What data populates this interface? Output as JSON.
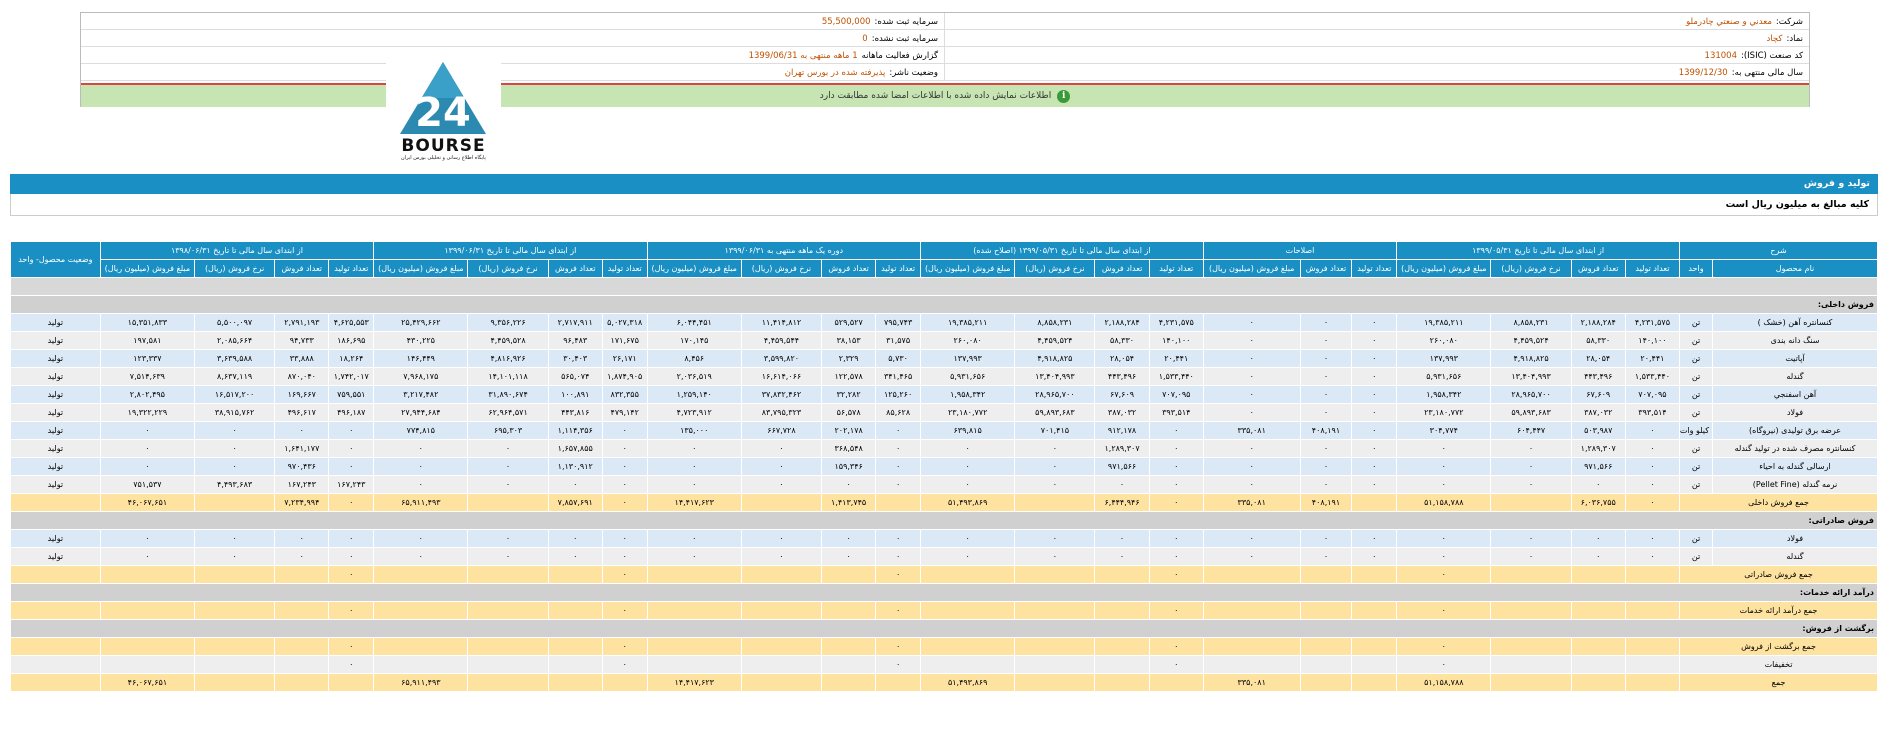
{
  "company": {
    "company_label": "شرکت:",
    "company_value": "معدني و صنعتي چادرملو",
    "symbol_label": "نماد:",
    "symbol_value": "کچاد",
    "isic_label": "کد صنعت (ISIC):",
    "isic_value": "131004",
    "fiscal_label": "سال مالی منتهی به:",
    "fiscal_value": "1399/12/30",
    "capital_label": "سرمایه ثبت شده:",
    "capital_value": "55,500,000",
    "unreg_label": "سرمایه ثبت نشده:",
    "unreg_value": "0",
    "report_label": "گزارش فعالیت ماهانه",
    "report_value": "1 ماهه منتهی به 1399/06/31",
    "status_label": "وضعیت ناشر:",
    "status_value": "پذیرفته شده در بورس تهران"
  },
  "notice": "اطلاعات نمایش داده شده با اطلاعات امضا شده مطابقت دارد",
  "logo": {
    "text": "BOURSE",
    "sub": "پایگاه اطلاع رسانی و تحلیلی بورس ایران",
    "mark": "24"
  },
  "section_title": "تولید و فروش",
  "section_note": "کلیه مبالغ به میلیون ریال است",
  "head": {
    "g0": "شرح",
    "g1": "از ابتدای سال مالی تا تاریخ ۱۳۹۹/۰۵/۳۱",
    "g2": "اصلاحات",
    "g3": "از ابتدای سال مالی تا تاریخ ۱۳۹۹/۰۵/۳۱ (اصلاح شده)",
    "g4": "دوره یک ماهه منتهی به ۱۳۹۹/۰۶/۳۱",
    "g5": "از ابتدای سال مالی تا تاریخ ۱۳۹۹/۰۶/۳۱",
    "g6": "از ابتدای سال مالی تا تاریخ ۱۳۹۸/۰۶/۳۱",
    "g7": "وضعیت محصول- واحد",
    "name": "نام محصول",
    "unit": "واحد",
    "prod": "تعداد تولید",
    "salesq": "تعداد فروش",
    "rate": "نرخ فروش (ریال)",
    "amount": "مبلغ فروش (میلیون ریال)"
  },
  "sections": {
    "domestic": "فروش داخلی:",
    "export": "فروش صادراتی:",
    "services": "درآمد ارائه خدمات:",
    "returns": "برگشت از فروش:"
  },
  "rows": [
    {
      "n": "کنسانتره آهن (خشک )",
      "u": "تن",
      "c": [
        "۴,۲۳۱,۵۷۵",
        "۲,۱۸۸,۲۸۴",
        "۸,۸۵۸,۲۳۱",
        "۱۹,۳۸۵,۲۱۱",
        "۰",
        "۰",
        "۰",
        "۴,۲۳۱,۵۷۵",
        "۲,۱۸۸,۲۸۴",
        "۸,۸۵۸,۲۳۱",
        "۱۹,۳۸۵,۲۱۱",
        "۷۹۵,۷۴۳",
        "۵۲۹,۵۲۷",
        "۱۱,۴۱۴,۸۱۲",
        "۶,۰۴۴,۴۵۱",
        "۵,۰۲۷,۳۱۸",
        "۲,۷۱۷,۹۱۱",
        "۹,۳۵۶,۲۲۶",
        "۲۵,۴۲۹,۶۶۲",
        "۴,۶۲۵,۵۵۳",
        "۲,۷۹۱,۱۹۳",
        "۵,۵۰۰,۰۹۷",
        "۱۵,۳۵۱,۸۳۳"
      ],
      "s": "تولید",
      "k": "r1"
    },
    {
      "n": "سنگ دانه بندی",
      "u": "تن",
      "c": [
        "۱۴۰,۱۰۰",
        "۵۸,۳۳۰",
        "۴,۴۵۹,۵۲۴",
        "۲۶۰,۰۸۰",
        "۰",
        "۰",
        "۰",
        "۱۴۰,۱۰۰",
        "۵۸,۳۳۰",
        "۴,۴۵۹,۵۲۴",
        "۲۶۰,۰۸۰",
        "۳۱,۵۷۵",
        "۳۸,۱۵۳",
        "۴,۴۵۹,۵۴۴",
        "۱۷۰,۱۴۵",
        "۱۷۱,۶۷۵",
        "۹۶,۴۸۳",
        "۴,۴۵۹,۵۲۸",
        "۴۳۰,۲۲۵",
        "۱۸۶,۶۹۵",
        "۹۴,۷۳۳",
        "۲,۰۸۵,۶۶۴",
        "۱۹۷,۵۸۱"
      ],
      "s": "تولید",
      "k": "r2"
    },
    {
      "n": "آپاتیت",
      "u": "تن",
      "c": [
        "۲۰,۴۴۱",
        "۲۸,۰۵۴",
        "۴,۹۱۸,۸۲۵",
        "۱۳۷,۹۹۳",
        "۰",
        "۰",
        "۰",
        "۲۰,۴۴۱",
        "۲۸,۰۵۴",
        "۴,۹۱۸,۸۲۵",
        "۱۳۷,۹۹۳",
        "۵,۷۳۰",
        "۲,۳۲۹",
        "۳,۵۹۹,۸۲۰",
        "۸,۴۵۶",
        "۲۶,۱۷۱",
        "۳۰,۴۰۳",
        "۴,۸۱۶,۹۲۶",
        "۱۴۶,۴۴۹",
        "۱۸,۲۶۴",
        "۳۳,۸۸۸",
        "۳,۶۳۹,۵۸۸",
        "۱۲۳,۳۳۷"
      ],
      "s": "تولید",
      "k": "r1"
    },
    {
      "n": "گندله",
      "u": "تن",
      "c": [
        "۱,۵۳۳,۴۴۰",
        "۴۴۳,۴۹۶",
        "۱۳,۴۰۴,۹۹۳",
        "۵,۹۳۱,۶۵۶",
        "۰",
        "۰",
        "۰",
        "۱,۵۳۳,۴۴۰",
        "۴۴۳,۴۹۶",
        "۱۳,۴۰۴,۹۹۳",
        "۵,۹۳۱,۶۵۶",
        "۳۴۱,۴۶۵",
        "۱۲۲,۵۷۸",
        "۱۶,۶۱۴,۰۶۶",
        "۲,۰۳۶,۵۱۹",
        "۱,۸۷۴,۹۰۵",
        "۵۶۵,۰۷۴",
        "۱۴,۱۰۱,۱۱۸",
        "۷,۹۶۸,۱۷۵",
        "۱,۷۴۲,۰۱۷",
        "۸۷۰,۰۴۰",
        "۸,۶۳۷,۱۱۹",
        "۷,۵۱۴,۶۳۹"
      ],
      "s": "تولید",
      "k": "r2"
    },
    {
      "n": "آهن اسفنجي",
      "u": "تن",
      "c": [
        "۷۰۷,۰۹۵",
        "۶۷,۶۰۹",
        "۲۸,۹۶۵,۷۰۰",
        "۱,۹۵۸,۳۴۲",
        "۰",
        "۰",
        "۰",
        "۷۰۷,۰۹۵",
        "۶۷,۶۰۹",
        "۲۸,۹۶۵,۷۰۰",
        "۱,۹۵۸,۳۴۲",
        "۱۲۵,۲۶۰",
        "۳۲,۲۸۲",
        "۳۷,۸۳۲,۴۶۲",
        "۱,۲۵۹,۱۴۰",
        "۸۳۲,۳۵۵",
        "۱۰۰,۸۹۱",
        "۳۱,۸۹۰,۶۷۴",
        "۳,۲۱۷,۴۸۲",
        "۷۵۹,۵۵۱",
        "۱۶۹,۶۶۷",
        "۱۶,۵۱۷,۲۰۰",
        "۲,۸۰۲,۴۹۵"
      ],
      "s": "تولید",
      "k": "r1"
    },
    {
      "n": "فولاد",
      "u": "تن",
      "c": [
        "۳۹۳,۵۱۴",
        "۳۸۷,۰۳۲",
        "۵۹,۸۹۳,۶۸۳",
        "۲۳,۱۸۰,۷۷۲",
        "۰",
        "۰",
        "۰",
        "۳۹۳,۵۱۴",
        "۳۸۷,۰۳۲",
        "۵۹,۸۹۳,۶۸۳",
        "۲۳,۱۸۰,۷۷۲",
        "۸۵,۶۲۸",
        "۵۶,۵۷۸",
        "۸۳,۷۹۵,۳۲۳",
        "۴,۷۲۳,۹۱۲",
        "۴۷۹,۱۴۲",
        "۴۴۳,۸۱۶",
        "۶۲,۹۶۴,۵۷۱",
        "۲۷,۹۴۴,۶۸۴",
        "۴۹۶,۱۸۷",
        "۴۹۶,۶۱۷",
        "۳۸,۹۱۵,۷۶۲",
        "۱۹,۳۲۲,۲۲۹"
      ],
      "s": "تولید",
      "k": "r2"
    },
    {
      "n": "عرضه برق تولیدی (نیروگاه)",
      "u": "کیلو وات",
      "c": [
        "۰",
        "۵۰۳,۹۸۷",
        "۶۰۴,۴۴۷",
        "۳۰۴,۷۷۴",
        "۰",
        "۴۰۸,۱۹۱",
        "۳۳۵,۰۸۱",
        "۰",
        "۹۱۲,۱۷۸",
        "۷۰۱,۴۱۵",
        "۶۳۹,۸۱۵",
        "۰",
        "۲۰۲,۱۷۸",
        "۶۶۷,۷۲۸",
        "۱۳۵,۰۰۰",
        "۰",
        "۱,۱۱۴,۳۵۶",
        "۶۹۵,۳۰۳",
        "۷۷۴,۸۱۵",
        "۰",
        "۰",
        "۰",
        "۰"
      ],
      "s": "تولید",
      "k": "r1",
      "tall": true
    },
    {
      "n": "کنسانتره مصرف شده در تولید گندله",
      "u": "تن",
      "c": [
        "۰",
        "۱,۲۸۹,۳۰۷",
        "۰",
        "۰",
        "۰",
        "۰",
        "۰",
        "۰",
        "۱,۲۸۹,۳۰۷",
        "۰",
        "۰",
        "۰",
        "۳۶۸,۵۴۸",
        "۰",
        "۰",
        "۰",
        "۱,۶۵۷,۸۵۵",
        "۰",
        "۰",
        "۰",
        "۱,۶۴۱,۱۷۷",
        "۰",
        "۰"
      ],
      "s": "تولید",
      "k": "r2",
      "tall": true
    },
    {
      "n": "ارسالی گندله به احیاء",
      "u": "تن",
      "c": [
        "۰",
        "۹۷۱,۵۶۶",
        "۰",
        "۰",
        "۰",
        "۰",
        "۰",
        "۰",
        "۹۷۱,۵۶۶",
        "۰",
        "۰",
        "۰",
        "۱۵۹,۳۴۶",
        "۰",
        "۰",
        "۰",
        "۱,۱۳۰,۹۱۲",
        "۰",
        "۰",
        "۰",
        "۹۷۰,۴۳۶",
        "۰",
        "۰"
      ],
      "s": "تولید",
      "k": "r1"
    },
    {
      "n": "نرمه گندله (Pellet Fine)",
      "u": "تن",
      "c": [
        "۰",
        "۰",
        "۰",
        "۰",
        "۰",
        "۰",
        "۰",
        "۰",
        "۰",
        "۰",
        "۰",
        "۰",
        "۰",
        "۰",
        "۰",
        "۰",
        "۰",
        "۰",
        "۰",
        "۱۶۷,۲۴۳",
        "۱۶۷,۲۴۳",
        "۴,۴۹۳,۶۸۳",
        "۷۵۱,۵۳۷"
      ],
      "s": "تولید",
      "k": "r2"
    }
  ],
  "domestic_total": {
    "n": "جمع فروش داخلی",
    "c": [
      "۰",
      "۶,۰۳۶,۷۵۵",
      "",
      "۵۱,۱۵۸,۷۸۸",
      "",
      "۴۰۸,۱۹۱",
      "۳۳۵,۰۸۱",
      "۰",
      "۶,۴۴۴,۹۴۶",
      "",
      "۵۱,۴۹۳,۸۶۹",
      "",
      "۱,۴۱۳,۷۴۵",
      "",
      "۱۴,۴۱۷,۶۲۳",
      "۰",
      "۷,۸۵۷,۶۹۱",
      "",
      "۶۵,۹۱۱,۴۹۳",
      "۰",
      "۷,۲۳۴,۹۹۴",
      "",
      "۴۶,۰۶۷,۶۵۱"
    ]
  },
  "export_rows": [
    {
      "n": "فولاد",
      "u": "تن",
      "s": "تولید",
      "k": "r1"
    },
    {
      "n": "گندله",
      "u": "تن",
      "s": "تولید",
      "k": "r2"
    }
  ],
  "export_total": "جمع فروش صادراتی",
  "services_total": "جمع درآمد ارائه خدمات",
  "returns_total": "جمع برگشت از فروش",
  "discounts": "تخفیفات",
  "grand_total": {
    "n": "جمع",
    "c": [
      "",
      "",
      "",
      "۵۱,۱۵۸,۷۸۸",
      "",
      "",
      "۳۳۵,۰۸۱",
      "",
      "",
      "",
      "۵۱,۴۹۳,۸۶۹",
      "",
      "",
      "",
      "۱۴,۴۱۷,۶۲۳",
      "",
      "",
      "",
      "۶۵,۹۱۱,۴۹۳",
      "",
      "",
      "",
      "۴۶,۰۶۷,۶۵۱"
    ]
  },
  "zero": "۰"
}
